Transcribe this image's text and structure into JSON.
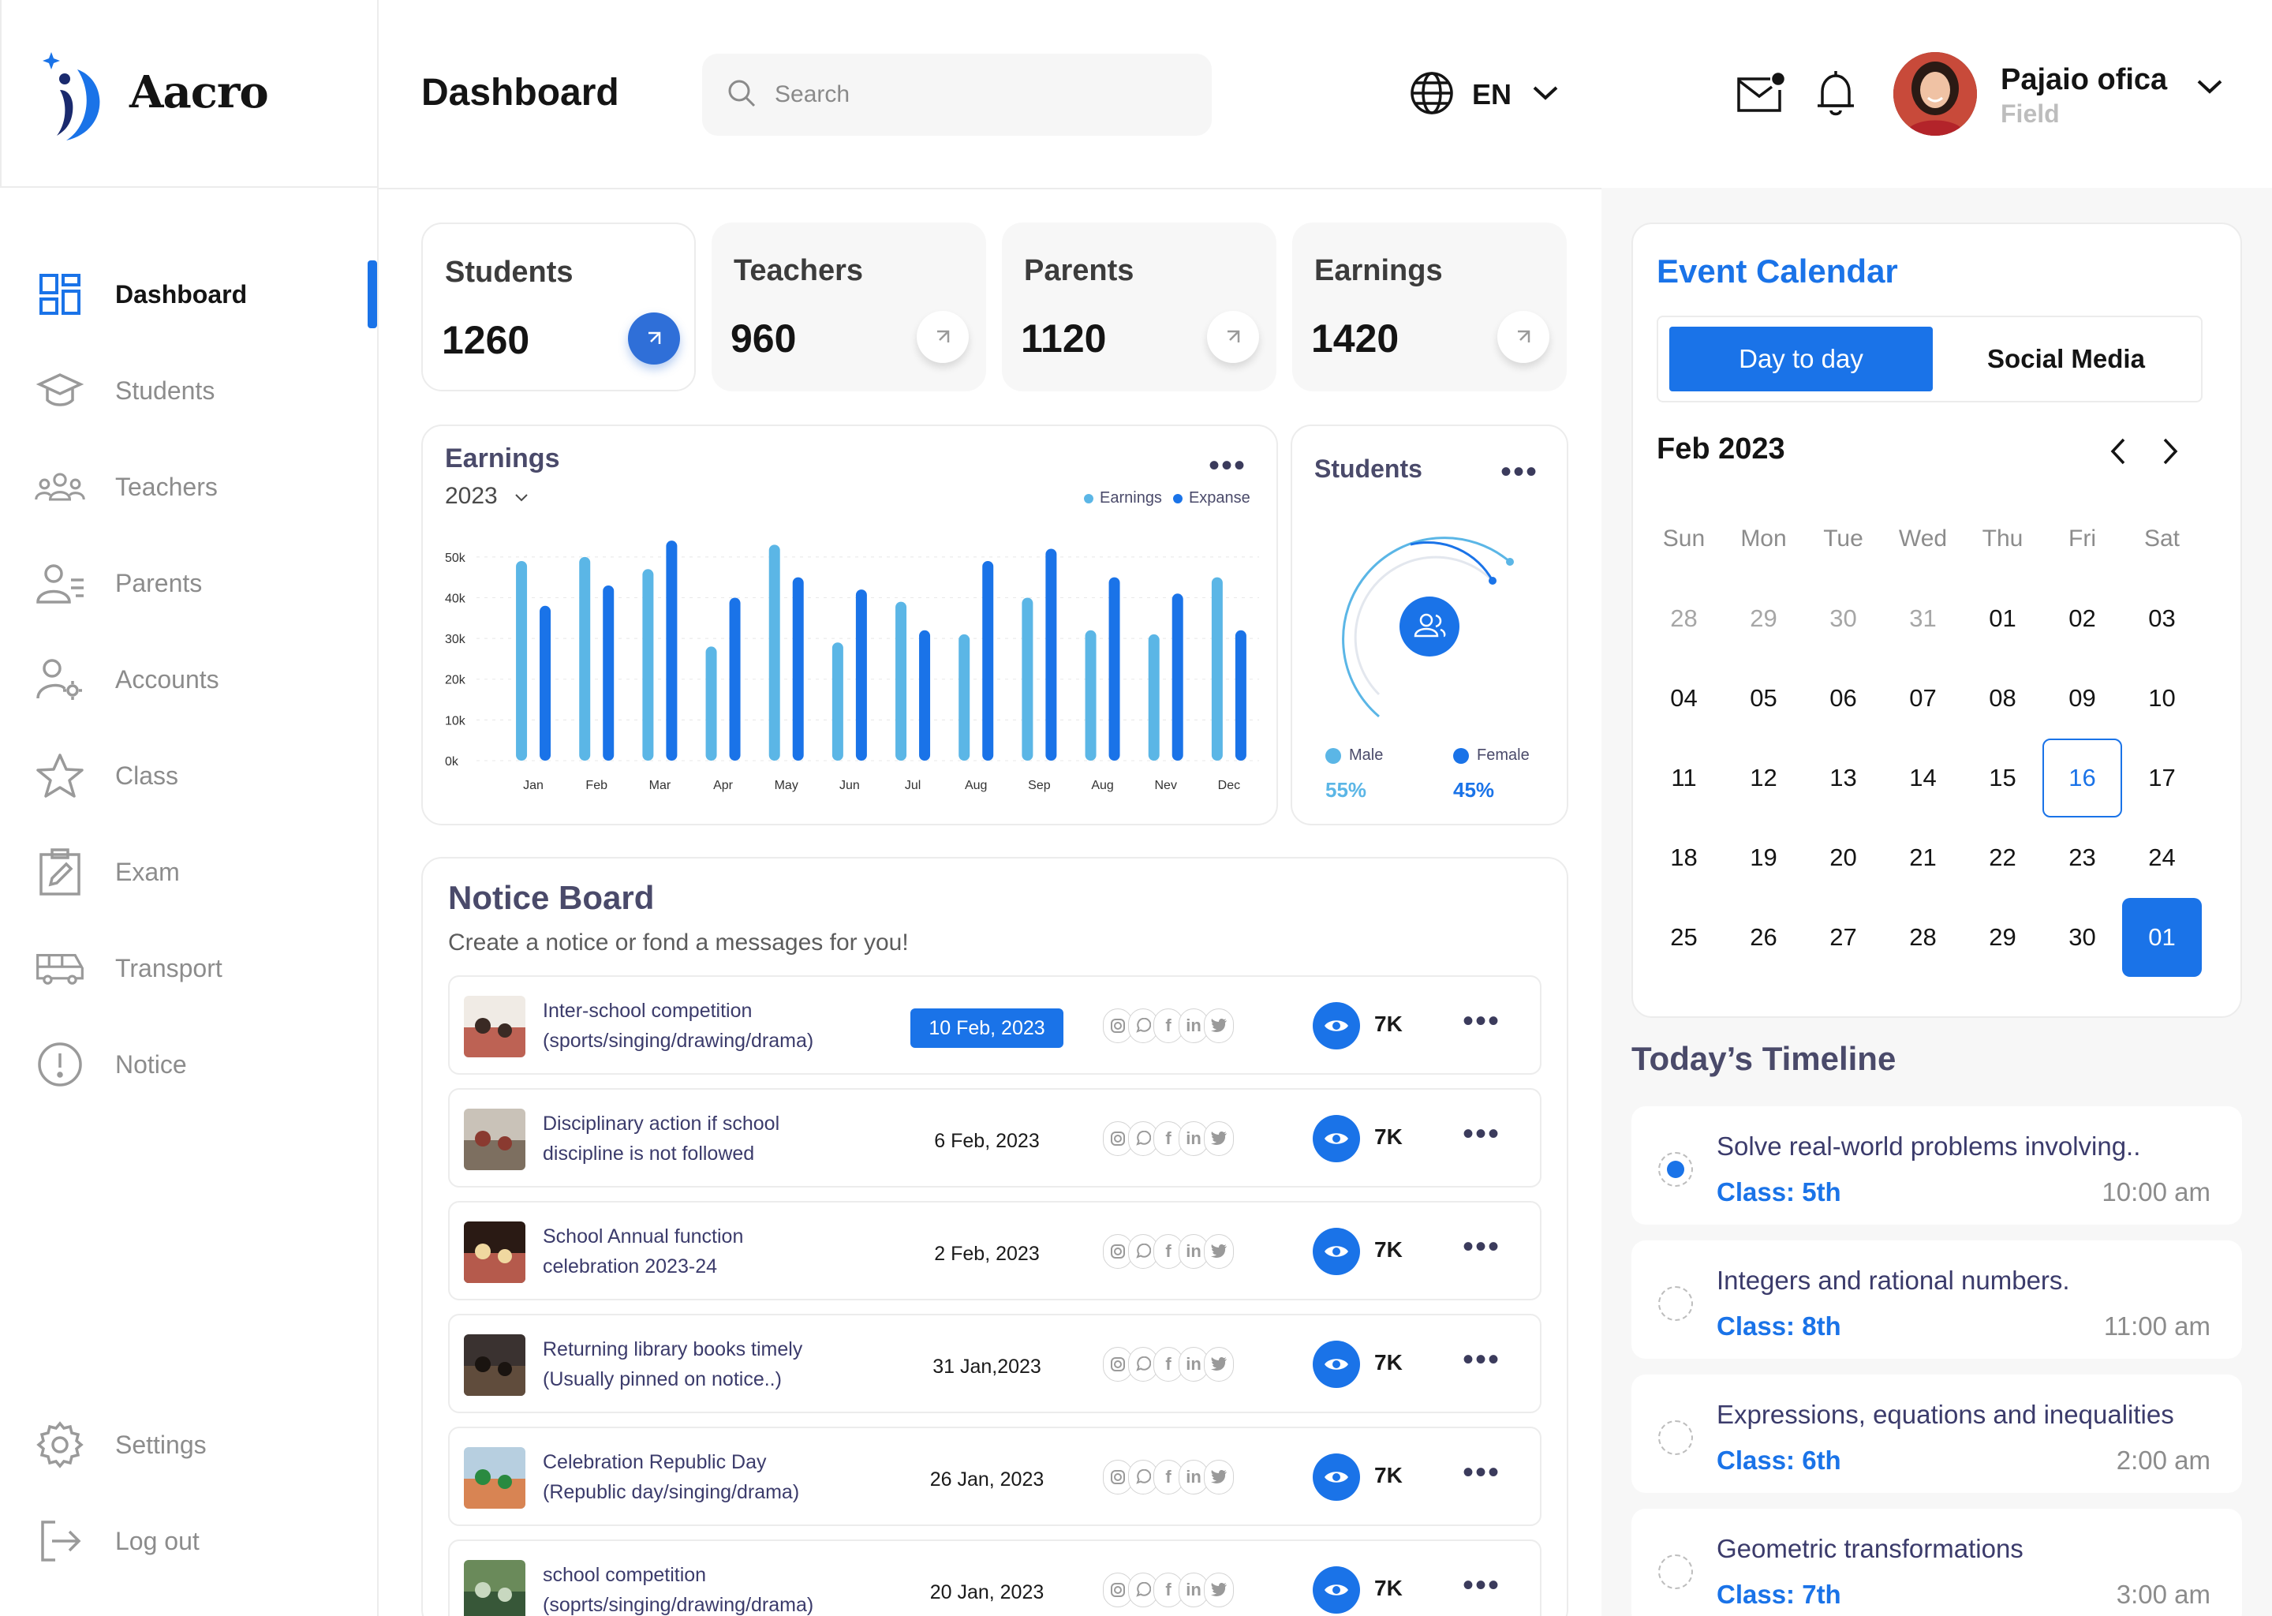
{
  "brand": {
    "name": "Aacro"
  },
  "sidebar": {
    "items": [
      {
        "label": "Dashboard",
        "icon": "dashboard-icon",
        "active": true
      },
      {
        "label": "Students",
        "icon": "graduation-cap-icon"
      },
      {
        "label": "Teachers",
        "icon": "group-icon"
      },
      {
        "label": "Parents",
        "icon": "parents-icon"
      },
      {
        "label": "Accounts",
        "icon": "user-gear-icon"
      },
      {
        "label": "Class",
        "icon": "star-icon"
      },
      {
        "label": "Exam",
        "icon": "clipboard-edit-icon"
      },
      {
        "label": "Transport",
        "icon": "bus-icon"
      },
      {
        "label": "Notice",
        "icon": "alert-circle-icon"
      }
    ],
    "bottom": [
      {
        "label": "Settings",
        "icon": "gear-icon"
      },
      {
        "label": "Log out",
        "icon": "logout-icon"
      }
    ]
  },
  "header": {
    "title": "Dashboard",
    "search_placeholder": "Search",
    "language": "EN",
    "user": {
      "name": "Pajaio ofica",
      "role": "Field"
    }
  },
  "stats": [
    {
      "label": "Students",
      "value": "1260"
    },
    {
      "label": "Teachers",
      "value": "960"
    },
    {
      "label": "Parents",
      "value": "1120"
    },
    {
      "label": "Earnings",
      "value": "1420"
    }
  ],
  "earnings": {
    "title": "Earnings",
    "year": "2023",
    "menu": "•••"
  },
  "chart_data": [
    {
      "type": "bar",
      "categories": [
        "Jan",
        "Feb",
        "Mar",
        "Apr",
        "May",
        "Jun",
        "Jul",
        "Aug",
        "Sep",
        "Aug",
        "Nev",
        "Dec"
      ],
      "series": [
        {
          "name": "Earnings",
          "values": [
            49,
            50,
            47,
            28,
            53,
            29,
            39,
            31,
            40,
            32,
            31,
            45
          ],
          "color": "#5BB6E6"
        },
        {
          "name": "Expanse",
          "values": [
            38,
            43,
            54,
            40,
            45,
            42,
            32,
            49,
            52,
            45,
            41,
            32
          ],
          "color": "#1A73E8"
        }
      ],
      "y_ticks": [
        "0k",
        "10k",
        "20k",
        "30k",
        "40k",
        "50k"
      ],
      "ylim": [
        0,
        55
      ],
      "grid": true,
      "legend": "top-right"
    }
  ],
  "students_gauge": {
    "title": "Students",
    "menu": "•••",
    "male": {
      "label": "Male",
      "value": "55%"
    },
    "female": {
      "label": "Female",
      "value": "45%"
    }
  },
  "notice_board": {
    "title": "Notice Board",
    "subtitle": "Create a notice or fond a messages for you!",
    "rows": [
      {
        "title_1": "Inter-school competition",
        "title_2": "(sports/singing/drawing/drama)",
        "date": "10 Feb, 2023",
        "views": "7K",
        "highlight": true
      },
      {
        "title_1": "Disciplinary action if school",
        "title_2": "discipline is not followed",
        "date": "6 Feb, 2023",
        "views": "7K"
      },
      {
        "title_1": "School Annual function",
        "title_2": "celebration 2023-24",
        "date": "2 Feb, 2023",
        "views": "7K"
      },
      {
        "title_1": "Returning library books timely",
        "title_2": "(Usually pinned on notice..)",
        "date": "31 Jan,2023",
        "views": "7K"
      },
      {
        "title_1": "Celebration Republic Day",
        "title_2": "(Republic day/singing/drama)",
        "date": "26 Jan, 2023",
        "views": "7K"
      },
      {
        "title_1": "school competition",
        "title_2": "(soprts/singing/drawing/drama)",
        "date": "20 Jan, 2023",
        "views": "7K"
      }
    ]
  },
  "calendar": {
    "title": "Event Calendar",
    "tabs": [
      "Day to day",
      "Social Media"
    ],
    "month": "Feb 2023",
    "weekdays": [
      "Sun",
      "Mon",
      "Tue",
      "Wed",
      "Thu",
      "Fri",
      "Sat"
    ],
    "days": [
      [
        "28",
        "29",
        "30",
        "31",
        "01",
        "02",
        "03"
      ],
      [
        "04",
        "05",
        "06",
        "07",
        "08",
        "09",
        "10"
      ],
      [
        "11",
        "12",
        "13",
        "14",
        "15",
        "16",
        "17"
      ],
      [
        "18",
        "19",
        "20",
        "21",
        "22",
        "23",
        "24"
      ],
      [
        "25",
        "26",
        "27",
        "28",
        "29",
        "30",
        "01"
      ]
    ],
    "today": "16",
    "selected": "01"
  },
  "timeline": {
    "title": "Today’s Timeline",
    "items": [
      {
        "text": "Solve real-world problems involving..",
        "class": "Class: 5th",
        "time": "10:00 am",
        "done": true
      },
      {
        "text": "Integers and rational numbers.",
        "class": "Class: 8th",
        "time": "11:00 am"
      },
      {
        "text": "Expressions, equations and inequalities",
        "class": "Class: 6th",
        "time": "2:00 am"
      },
      {
        "text": "Geometric transformations",
        "class": "Class: 7th",
        "time": "3:00 am"
      }
    ]
  }
}
